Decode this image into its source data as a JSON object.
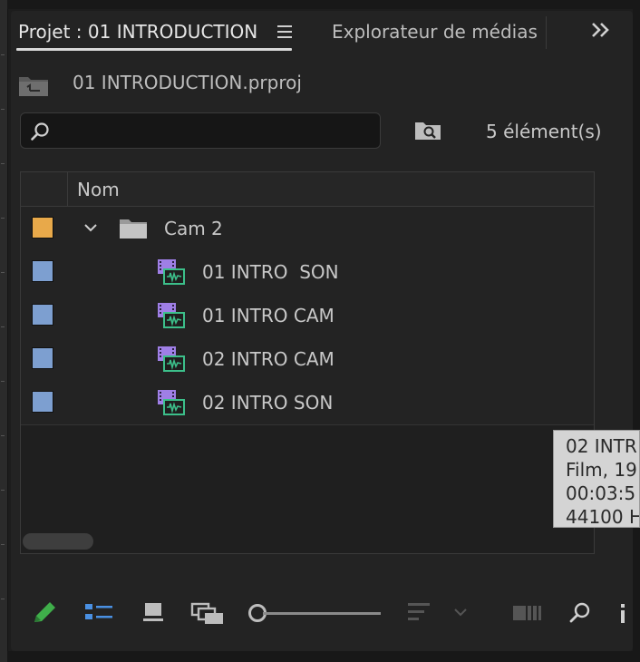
{
  "tabs": {
    "project_tab": "Projet : 01 INTRODUCTION",
    "media_browser_tab": "Explorateur de médias",
    "overflow_icon": "double-chevron-right-icon"
  },
  "project": {
    "file_name": "01 INTRODUCTION.prproj",
    "search": {
      "value": "",
      "placeholder": ""
    },
    "item_count": "5 élément(s)"
  },
  "list": {
    "header": {
      "name_column": "Nom"
    },
    "rows": [
      {
        "label": "Cam 2",
        "type": "bin",
        "expanded": true,
        "color": "#e8a94a"
      },
      {
        "label": "01 INTRO  SON",
        "type": "clip",
        "color": "#7d9fd0"
      },
      {
        "label": "01 INTRO CAM",
        "type": "clip",
        "color": "#7d9fd0"
      },
      {
        "label": "02 INTRO CAM",
        "type": "clip",
        "color": "#7d9fd0"
      },
      {
        "label": "02 INTRO SON",
        "type": "clip",
        "color": "#7d9fd0"
      }
    ]
  },
  "tooltip": {
    "line1": "02 INTR",
    "line2": "Film, 19",
    "line3": "00:03:5",
    "line4": "44100 H"
  },
  "toolbar": {
    "icons": [
      "pencil-icon",
      "list-view-icon",
      "icon-view-icon",
      "freeform-view-icon",
      "zoom-slider",
      "sort-icon",
      "automate-to-sequence-icon",
      "find-icon",
      "new-item-icon"
    ],
    "accent_color": "#4a90e2",
    "pencil_color": "#3fae4a"
  },
  "colors": {
    "bin_label": "#e8a94a",
    "clip_label": "#7d9fd0",
    "clip_icon": "#9f7fe6",
    "clip_audio": "#3cbf8a"
  }
}
